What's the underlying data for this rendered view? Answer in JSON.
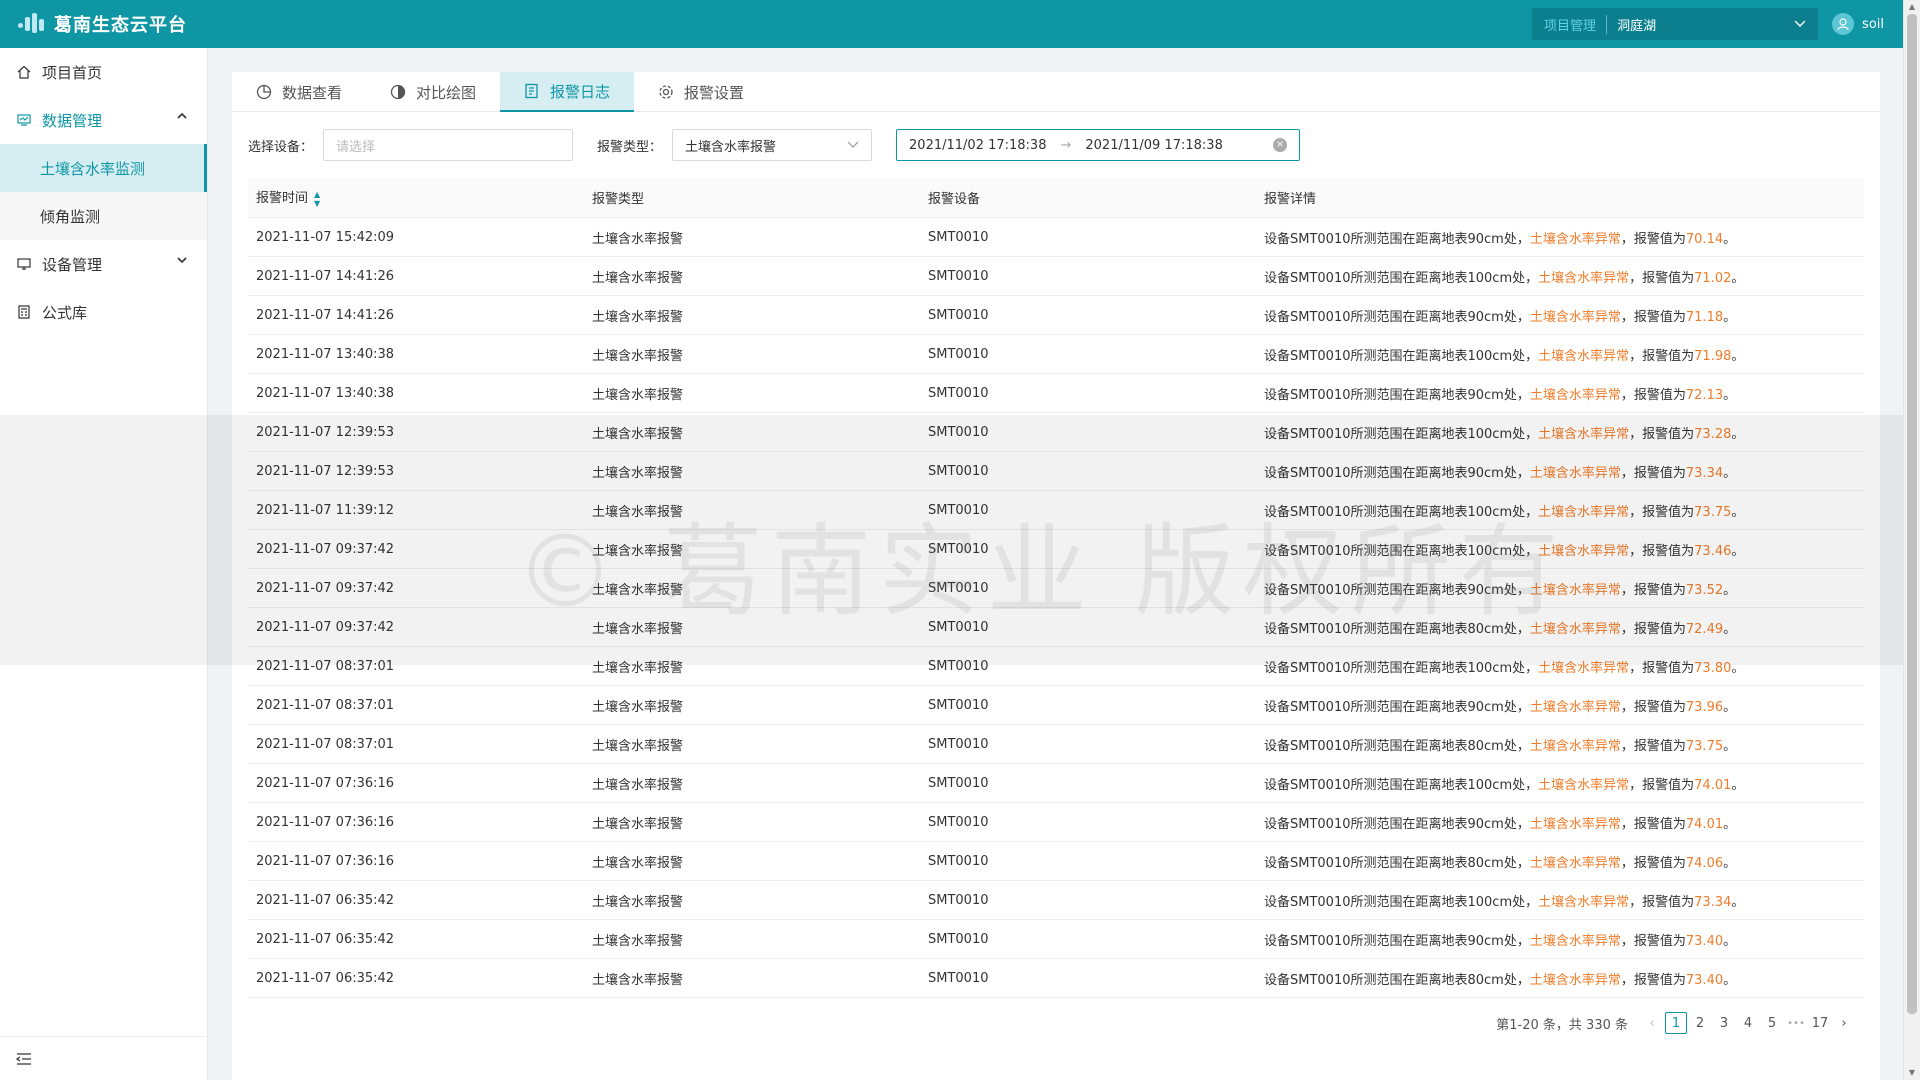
{
  "header": {
    "app_title": "葛南生态云平台",
    "project_label": "项目管理",
    "project_value": "洞庭湖",
    "username": "soil"
  },
  "sidebar": {
    "items": [
      {
        "label": "项目首页",
        "icon": "home-icon"
      },
      {
        "label": "数据管理",
        "icon": "monitor-icon",
        "expanded": true,
        "children": [
          {
            "label": "土壤含水率监测",
            "active": true
          },
          {
            "label": "倾角监测",
            "active": false
          }
        ]
      },
      {
        "label": "设备管理",
        "icon": "desktop-icon",
        "expanded": false
      },
      {
        "label": "公式库",
        "icon": "calculator-icon"
      }
    ]
  },
  "tabs": [
    {
      "label": "数据查看",
      "icon": "pie-chart-icon"
    },
    {
      "label": "对比绘图",
      "icon": "contrast-icon"
    },
    {
      "label": "报警日志",
      "icon": "log-icon",
      "active": true
    },
    {
      "label": "报警设置",
      "icon": "gear-icon"
    }
  ],
  "filters": {
    "device_label": "选择设备：",
    "device_placeholder": "请选择",
    "type_label": "报警类型：",
    "type_value": "土壤含水率报警",
    "range_start": "2021/11/02 17:18:38",
    "range_sep": "→",
    "range_end": "2021/11/09 17:18:38"
  },
  "table": {
    "columns": [
      "报警时间",
      "报警类型",
      "报警设备",
      "报警详情"
    ],
    "rows": [
      {
        "time": "2021-11-07 15:42:09",
        "type": "土壤含水率报警",
        "device": "SMT0010",
        "prefix": "设备SMT0010所测范围在距离地表90cm处，",
        "tag": "土壤含水率异常",
        "mid": "，报警值为",
        "value": "70.14",
        "end": "。"
      },
      {
        "time": "2021-11-07 14:41:26",
        "type": "土壤含水率报警",
        "device": "SMT0010",
        "prefix": "设备SMT0010所测范围在距离地表100cm处，",
        "tag": "土壤含水率异常",
        "mid": "，报警值为",
        "value": "71.02",
        "end": "。"
      },
      {
        "time": "2021-11-07 14:41:26",
        "type": "土壤含水率报警",
        "device": "SMT0010",
        "prefix": "设备SMT0010所测范围在距离地表90cm处，",
        "tag": "土壤含水率异常",
        "mid": "，报警值为",
        "value": "71.18",
        "end": "。"
      },
      {
        "time": "2021-11-07 13:40:38",
        "type": "土壤含水率报警",
        "device": "SMT0010",
        "prefix": "设备SMT0010所测范围在距离地表100cm处，",
        "tag": "土壤含水率异常",
        "mid": "，报警值为",
        "value": "71.98",
        "end": "。"
      },
      {
        "time": "2021-11-07 13:40:38",
        "type": "土壤含水率报警",
        "device": "SMT0010",
        "prefix": "设备SMT0010所测范围在距离地表90cm处，",
        "tag": "土壤含水率异常",
        "mid": "，报警值为",
        "value": "72.13",
        "end": "。"
      },
      {
        "time": "2021-11-07 12:39:53",
        "type": "土壤含水率报警",
        "device": "SMT0010",
        "prefix": "设备SMT0010所测范围在距离地表100cm处，",
        "tag": "土壤含水率异常",
        "mid": "，报警值为",
        "value": "73.28",
        "end": "。"
      },
      {
        "time": "2021-11-07 12:39:53",
        "type": "土壤含水率报警",
        "device": "SMT0010",
        "prefix": "设备SMT0010所测范围在距离地表90cm处，",
        "tag": "土壤含水率异常",
        "mid": "，报警值为",
        "value": "73.34",
        "end": "。"
      },
      {
        "time": "2021-11-07 11:39:12",
        "type": "土壤含水率报警",
        "device": "SMT0010",
        "prefix": "设备SMT0010所测范围在距离地表100cm处，",
        "tag": "土壤含水率异常",
        "mid": "，报警值为",
        "value": "73.75",
        "end": "。"
      },
      {
        "time": "2021-11-07 09:37:42",
        "type": "土壤含水率报警",
        "device": "SMT0010",
        "prefix": "设备SMT0010所测范围在距离地表100cm处，",
        "tag": "土壤含水率异常",
        "mid": "，报警值为",
        "value": "73.46",
        "end": "。"
      },
      {
        "time": "2021-11-07 09:37:42",
        "type": "土壤含水率报警",
        "device": "SMT0010",
        "prefix": "设备SMT0010所测范围在距离地表90cm处，",
        "tag": "土壤含水率异常",
        "mid": "，报警值为",
        "value": "73.52",
        "end": "。"
      },
      {
        "time": "2021-11-07 09:37:42",
        "type": "土壤含水率报警",
        "device": "SMT0010",
        "prefix": "设备SMT0010所测范围在距离地表80cm处，",
        "tag": "土壤含水率异常",
        "mid": "，报警值为",
        "value": "72.49",
        "end": "。"
      },
      {
        "time": "2021-11-07 08:37:01",
        "type": "土壤含水率报警",
        "device": "SMT0010",
        "prefix": "设备SMT0010所测范围在距离地表100cm处，",
        "tag": "土壤含水率异常",
        "mid": "，报警值为",
        "value": "73.80",
        "end": "。"
      },
      {
        "time": "2021-11-07 08:37:01",
        "type": "土壤含水率报警",
        "device": "SMT0010",
        "prefix": "设备SMT0010所测范围在距离地表90cm处，",
        "tag": "土壤含水率异常",
        "mid": "，报警值为",
        "value": "73.96",
        "end": "。"
      },
      {
        "time": "2021-11-07 08:37:01",
        "type": "土壤含水率报警",
        "device": "SMT0010",
        "prefix": "设备SMT0010所测范围在距离地表80cm处，",
        "tag": "土壤含水率异常",
        "mid": "，报警值为",
        "value": "73.75",
        "end": "。"
      },
      {
        "time": "2021-11-07 07:36:16",
        "type": "土壤含水率报警",
        "device": "SMT0010",
        "prefix": "设备SMT0010所测范围在距离地表100cm处，",
        "tag": "土壤含水率异常",
        "mid": "，报警值为",
        "value": "74.01",
        "end": "。"
      },
      {
        "time": "2021-11-07 07:36:16",
        "type": "土壤含水率报警",
        "device": "SMT0010",
        "prefix": "设备SMT0010所测范围在距离地表90cm处，",
        "tag": "土壤含水率异常",
        "mid": "，报警值为",
        "value": "74.01",
        "end": "。"
      },
      {
        "time": "2021-11-07 07:36:16",
        "type": "土壤含水率报警",
        "device": "SMT0010",
        "prefix": "设备SMT0010所测范围在距离地表80cm处，",
        "tag": "土壤含水率异常",
        "mid": "，报警值为",
        "value": "74.06",
        "end": "。"
      },
      {
        "time": "2021-11-07 06:35:42",
        "type": "土壤含水率报警",
        "device": "SMT0010",
        "prefix": "设备SMT0010所测范围在距离地表100cm处，",
        "tag": "土壤含水率异常",
        "mid": "，报警值为",
        "value": "73.34",
        "end": "。"
      },
      {
        "time": "2021-11-07 06:35:42",
        "type": "土壤含水率报警",
        "device": "SMT0010",
        "prefix": "设备SMT0010所测范围在距离地表90cm处，",
        "tag": "土壤含水率异常",
        "mid": "，报警值为",
        "value": "73.40",
        "end": "。"
      },
      {
        "time": "2021-11-07 06:35:42",
        "type": "土壤含水率报警",
        "device": "SMT0010",
        "prefix": "设备SMT0010所测范围在距离地表80cm处，",
        "tag": "土壤含水率异常",
        "mid": "，报警值为",
        "value": "73.40",
        "end": "。"
      }
    ]
  },
  "pagination": {
    "total_text": "第1-20 条，共 330 条",
    "pages": [
      "1",
      "2",
      "3",
      "4",
      "5"
    ],
    "ellipsis": "•••",
    "last_page": "17",
    "current": "1"
  },
  "watermark": "© 葛南实业 版权所有",
  "colors": {
    "primary": "#0e96a5",
    "highlight": "#f07c2a",
    "active_bg": "#d6eef1"
  }
}
